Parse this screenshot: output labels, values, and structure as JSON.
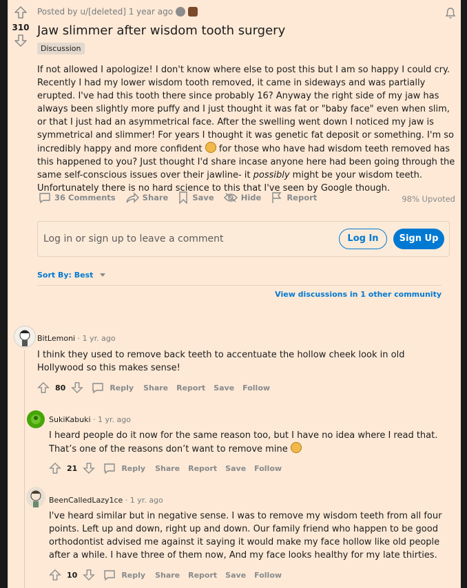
{
  "post": {
    "score": "310",
    "meta": "Posted by u/[deleted] 1 year ago",
    "title": "Jaw slimmer after wisdom tooth surgery",
    "flair": "Discussion",
    "body_html_parts": [
      "If not allowed I apologize! I don't know where else to post this but I am so happy I could cry. Recently I had my lower wisdom tooth removed, it came in sideways and was partially erupted. I've had this tooth there since probably 16? Anyway the right side of my jaw has always been slightly more puffy and I just thought it was fat or \"baby face\" even when slim, or that I just had an asymmetrical face. After the swelling went down I noticed my jaw is symmetrical and slimmer! For years I thought it was genetic fat deposit or something. I'm so incredibly happy and more confident ",
      " for those who have had wisdom teeth removed has this happened to you? Just thought I'd share incase anyone here had been going through the same self-conscious issues over their jawline- it ",
      "possibly",
      " might be your wisdom teeth. Unfortunately there is no hard science to this that I've seen by Google though."
    ],
    "actions": {
      "comments": "36 Comments",
      "share": "Share",
      "save": "Save",
      "hide": "Hide",
      "report": "Report"
    },
    "upvoted": "98% Upvoted"
  },
  "login": {
    "prompt": "Log in or sign up to leave a comment",
    "login_label": "Log In",
    "signup_label": "Sign Up"
  },
  "sort": {
    "label": "Sort By: Best"
  },
  "view_discussions": "View discussions in 1 other community",
  "comments": [
    {
      "author": "BitLemoni",
      "time": "· 1 yr. ago",
      "text": "I think they used to remove back teeth to accentuate the hollow cheek look in old Hollywood so this makes sense!",
      "score": "80",
      "actions": [
        "Reply",
        "Share",
        "Report",
        "Save",
        "Follow"
      ]
    },
    {
      "author": "SukiKabuki",
      "time": "· 1 yr. ago",
      "text": "I heard people do it now for the same reason too, but I have no idea where I read that. That’s one of the reasons don’t want to remove mine",
      "score": "21",
      "actions": [
        "Reply",
        "Share",
        "Report",
        "Save",
        "Follow"
      ]
    },
    {
      "author": "BeenCalledLazy1ce",
      "time": "· 1 yr. ago",
      "text": "I've heard similar but in negative sense. I was to remove my wisdom teeth from all four points. Left up and down, right up and down. Our family friend who happen to be good orthodontist advised me against it saying it would make my face hollow like old people after a while. I have three of them now, And my face looks healthy for my late thirties.",
      "score": "10",
      "actions": [
        "Reply",
        "Share",
        "Report",
        "Save",
        "Follow"
      ]
    }
  ],
  "colors": {
    "panel_bg": "#fde9d6",
    "accent": "#0079d3",
    "muted": "#878a8c"
  }
}
